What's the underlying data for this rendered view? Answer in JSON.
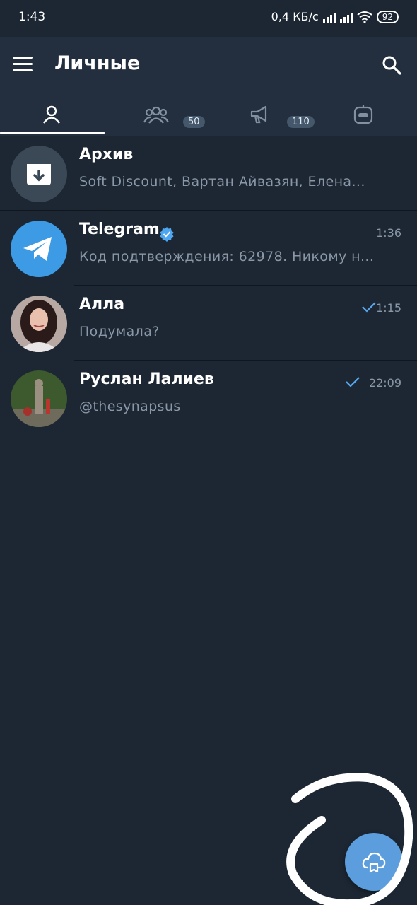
{
  "status_bar": {
    "time": "1:43",
    "network_speed": "0,4 КБ/с",
    "battery": "92"
  },
  "toolbar": {
    "title": "Личные",
    "menu_icon": "menu-icon",
    "search_icon": "search-icon"
  },
  "tabs": [
    {
      "icon": "person-icon",
      "badge": "",
      "active": true
    },
    {
      "icon": "group-icon",
      "badge": "50",
      "active": false
    },
    {
      "icon": "megaphone-icon",
      "badge": "110",
      "active": false
    },
    {
      "icon": "bot-icon",
      "badge": "",
      "active": false
    }
  ],
  "chats": [
    {
      "name": "Архив",
      "preview": "Soft Discount, Вартан Айвазян, Елена...",
      "time": "",
      "avatar": "archive-icon"
    },
    {
      "name": "Telegram",
      "preview": "Код подтверждения: 62978. Никому н...",
      "time": "1:36",
      "verified": true,
      "avatar": "telegram-icon"
    },
    {
      "name": "Алла",
      "preview": "Подумала?",
      "time": "1:15",
      "read_check": true,
      "avatar": "photo"
    },
    {
      "name": "Руслан Лалиев",
      "preview": "@thesynapsus",
      "time": "22:09",
      "read_check": true,
      "avatar": "photo"
    }
  ],
  "fab": {
    "icon": "cloud-icon"
  },
  "colors": {
    "background": "#1d2733",
    "toolbar": "#232f3e",
    "accent": "#5b9ddd",
    "muted_text": "#8a97a6"
  }
}
